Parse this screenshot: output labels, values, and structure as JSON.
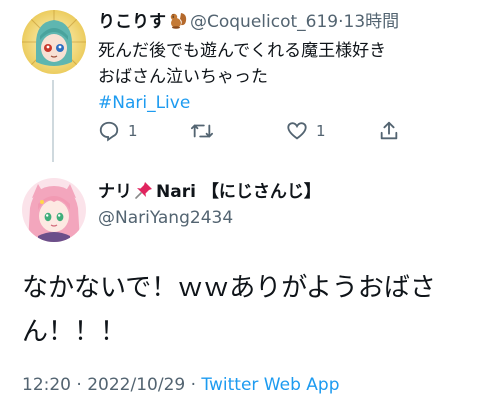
{
  "tweet1": {
    "name": "りこりす",
    "handle": "@Coquelicot_619",
    "separator": "·",
    "time": "13時間",
    "text_lines": [
      "死んだ後でも遊んでくれる魔王様好き",
      "おばさん泣いちゃった"
    ],
    "hashtag": "#Nari_Live",
    "reply_count": "1",
    "like_count": "1",
    "icons": {
      "reply": "reply-icon",
      "retweet": "retweet-icon",
      "like": "heart-icon",
      "share": "share-icon",
      "name_emoji": "squirrel-icon"
    }
  },
  "tweet2": {
    "name_prefix": "ナリ",
    "name_suffix": "Nari 【にじさんじ】",
    "handle": "@NariYang2434",
    "text_lines": [
      "なかないで！ｗｗありがようおばさ",
      "ん！！！"
    ],
    "time": "12:20",
    "separator": "·",
    "date": "2022/10/29",
    "app": "Twitter Web App",
    "icons": {
      "name_emoji": "pushpin-icon"
    }
  },
  "colors": {
    "text": "#0f1419",
    "muted": "#536471",
    "link": "#1d9bf0",
    "thread_line": "#cfd9de"
  }
}
